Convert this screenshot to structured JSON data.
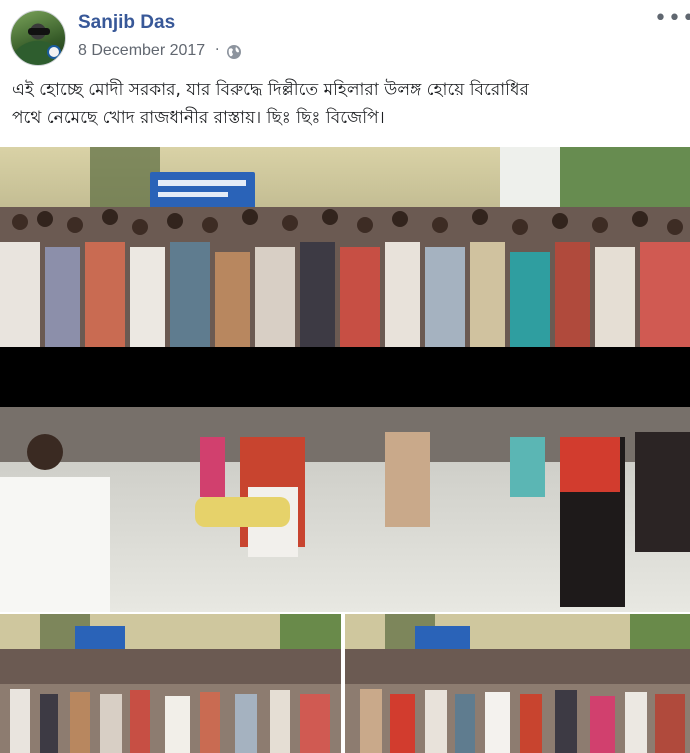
{
  "post": {
    "author": "Sanjib Das",
    "timestamp": "8 December 2017",
    "separator": "·",
    "privacy_icon": "globe-icon",
    "options_icon": "more-options-icon",
    "options_glyph": "•••",
    "text_line1": "এই হোচ্ছে মোদী সরকার, যার বিরুদ্ধে দিল্লীতে মহিলারা উলঙ্গ হোয়ে বিরোধির",
    "text_line2": "পথে নেমেছে খোদ রাজধানীর রাস্তায়। ছিঃ ছিঃ বিজেপি।"
  },
  "colors": {
    "author_link": "#385898",
    "meta_gray": "#616770",
    "redaction_bar": "#000000"
  },
  "photos": {
    "main": "crowd of people on a street, with a black redaction bar across the middle",
    "bottom_left": "crowd on street, thumbnail",
    "bottom_right": "crowd on street, thumbnail"
  }
}
